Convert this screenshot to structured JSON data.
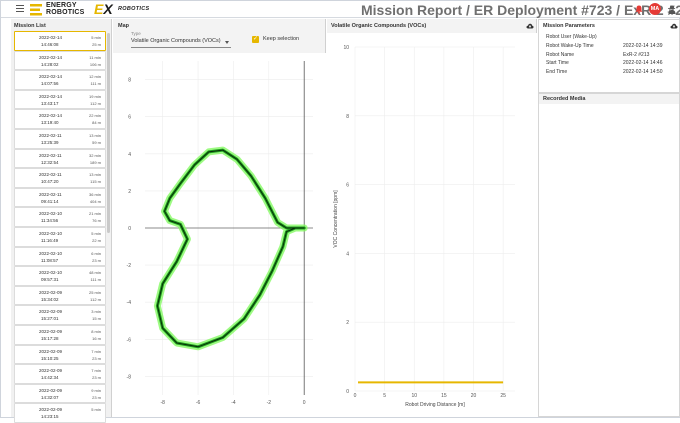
{
  "header": {
    "logo_line1": "ENERGY",
    "logo_line2": "ROBOTICS",
    "logo_ex": "EX",
    "logo_robotics": "ROBOTICS",
    "title": "Mission Report / ER Deployment #723 /  ExR-2 #213",
    "avatar_initials": "MA",
    "icons": [
      "menu-icon",
      "bell-icon",
      "user-icon"
    ],
    "colors": {
      "accent": "#e6b700",
      "avatar": "#e53935",
      "title": "#707070"
    }
  },
  "mission_list": {
    "title": "Mission List",
    "items": [
      {
        "date": "2022-02-14",
        "time": "14:46:08",
        "duration": "5 min",
        "distance": "25 m",
        "selected": true
      },
      {
        "date": "2022-02-14",
        "time": "14:28:02",
        "duration": "11 min",
        "distance": "106 m"
      },
      {
        "date": "2022-02-14",
        "time": "14:07:56",
        "duration": "12 min",
        "distance": "111 m"
      },
      {
        "date": "2022-02-14",
        "time": "13:43:17",
        "duration": "19 min",
        "distance": "112 m"
      },
      {
        "date": "2022-02-14",
        "time": "13:19:40",
        "duration": "22 min",
        "distance": "84 m"
      },
      {
        "date": "2022-02-11",
        "time": "13:25:39",
        "duration": "13 min",
        "distance": "59 m"
      },
      {
        "date": "2022-02-11",
        "time": "12:32:54",
        "duration": "32 min",
        "distance": "189 m"
      },
      {
        "date": "2022-02-11",
        "time": "10:47:20",
        "duration": "13 min",
        "distance": "115 m"
      },
      {
        "date": "2022-02-11",
        "time": "09:41:14",
        "duration": "36 min",
        "distance": "404 m"
      },
      {
        "date": "2022-02-10",
        "time": "11:34:56",
        "duration": "21 min",
        "distance": "76 m"
      },
      {
        "date": "2022-02-10",
        "time": "11:16:49",
        "duration": "5 min",
        "distance": "22 m"
      },
      {
        "date": "2022-02-10",
        "time": "11:08:57",
        "duration": "6 min",
        "distance": "23 m"
      },
      {
        "date": "2022-02-10",
        "time": "09:57:31",
        "duration": "48 min",
        "distance": "111 m"
      },
      {
        "date": "2022-02-09",
        "time": "15:34:02",
        "duration": "25 min",
        "distance": "112 m"
      },
      {
        "date": "2022-02-09",
        "time": "15:27:01",
        "duration": "3 min",
        "distance": "15 m"
      },
      {
        "date": "2022-02-09",
        "time": "15:17:28",
        "duration": "8 min",
        "distance": "16 m"
      },
      {
        "date": "2022-02-09",
        "time": "15:10:25",
        "duration": "7 min",
        "distance": "23 m"
      },
      {
        "date": "2022-02-09",
        "time": "14:42:34",
        "duration": "7 min",
        "distance": "23 m"
      },
      {
        "date": "2022-02-09",
        "time": "14:32:07",
        "duration": "9 min",
        "distance": "23 m"
      },
      {
        "date": "2022-02-09",
        "time": "14:23:15",
        "duration": "5 min",
        "distance": ""
      }
    ]
  },
  "map": {
    "title": "Map",
    "type_label": "Type",
    "type_value": "Volatile Organic Compounds (VOCs)",
    "keep_selection_label": "Keep selection",
    "keep_selection_checked": true
  },
  "voc": {
    "title": "Volatile Organic Compounds (VOCs)"
  },
  "params": {
    "title": "Mission Parameters",
    "rows": [
      {
        "key": "Robot User (Wake-Up)",
        "value": ""
      },
      {
        "key": "Robot Wake-Up Time",
        "value": "2022-02-14 14:39"
      },
      {
        "key": "Robot Name",
        "value": "ExR-2 #213"
      },
      {
        "key": "Start Time",
        "value": "2022-02-14 14:46"
      },
      {
        "key": "End Time",
        "value": "2022-02-14 14:50"
      }
    ]
  },
  "media": {
    "title": "Recorded Media"
  },
  "chart_data": [
    {
      "type": "line",
      "title": "",
      "xlabel": "",
      "ylabel": "",
      "xlim": [
        -9,
        0.5
      ],
      "ylim": [
        -9,
        9
      ],
      "xticks": [
        -8,
        -6,
        -4,
        -2,
        0
      ],
      "yticks": [
        8,
        6,
        4,
        2,
        0,
        -2,
        -4,
        -6,
        -8
      ],
      "grid": true,
      "series": [
        {
          "color": "#1f9e1f",
          "x": [
            0,
            -1,
            -1.5,
            -2.2,
            -3,
            -3.8,
            -4.6,
            -5.4,
            -6.2,
            -7,
            -7.6,
            -7.9,
            -7.6,
            -7.0,
            -6.6,
            -7.2,
            -8.0,
            -8.3,
            -8.0,
            -7.2,
            -6.0,
            -4.6,
            -3.4,
            -2.5,
            -1.8,
            -1.2,
            -1.0,
            -0.5,
            0
          ],
          "y": [
            0,
            0,
            0.3,
            1.6,
            2.8,
            3.7,
            4.2,
            4.1,
            3.4,
            2.4,
            1.6,
            0.9,
            0.4,
            0.2,
            -0.6,
            -1.8,
            -3.0,
            -4.2,
            -5.4,
            -6.2,
            -6.4,
            -5.9,
            -4.9,
            -3.6,
            -2.3,
            -1.0,
            -0.2,
            0.0,
            0.0
          ]
        }
      ]
    },
    {
      "type": "line",
      "title": "",
      "xlabel": "Robot Driving Distance [m]",
      "ylabel": "VOC Concentration [ppm]",
      "xlim": [
        0,
        27
      ],
      "ylim": [
        0,
        10
      ],
      "xticks": [
        0,
        5,
        10,
        15,
        20,
        25
      ],
      "yticks": [
        10,
        8,
        6,
        4,
        2,
        0
      ],
      "grid": true,
      "series": [
        {
          "color": "#e6b700",
          "x": [
            0.5,
            25
          ],
          "y": [
            0.25,
            0.25
          ]
        }
      ]
    }
  ]
}
